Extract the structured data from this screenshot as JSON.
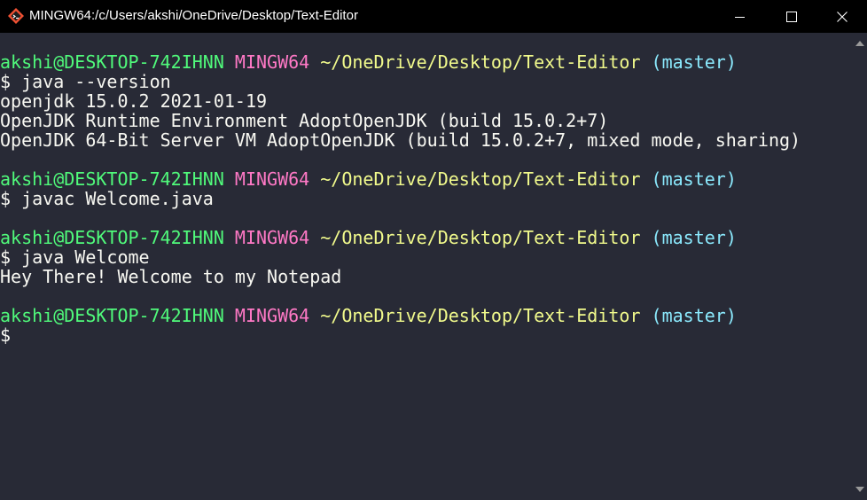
{
  "window": {
    "title": "MINGW64:/c/Users/akshi/OneDrive/Desktop/Text-Editor",
    "icon": "git-bash-icon"
  },
  "controls": {
    "minimize_icon": "minimize-icon",
    "maximize_icon": "maximize-icon",
    "close_icon": "close-icon"
  },
  "colors": {
    "background": "#282a36",
    "foreground": "#f8f8f2",
    "user_host": "#50fa7b",
    "msystem": "#ff79c6",
    "path": "#f1fa8c",
    "branch": "#8be9fd"
  },
  "prompt": {
    "user_host": "akshi@DESKTOP-742IHNN",
    "msystem": "MINGW64",
    "path": "~/OneDrive/Desktop/Text-Editor",
    "branch": "(master)"
  },
  "session": {
    "cmd1": "$ java --version",
    "out1": [
      "openjdk 15.0.2 2021-01-19",
      "OpenJDK Runtime Environment AdoptOpenJDK (build 15.0.2+7)",
      "OpenJDK 64-Bit Server VM AdoptOpenJDK (build 15.0.2+7, mixed mode, sharing)"
    ],
    "cmd2": "$ javac Welcome.java",
    "cmd3": "$ java Welcome",
    "out3": "Hey There! Welcome to my Notepad",
    "cmd4": "$"
  }
}
